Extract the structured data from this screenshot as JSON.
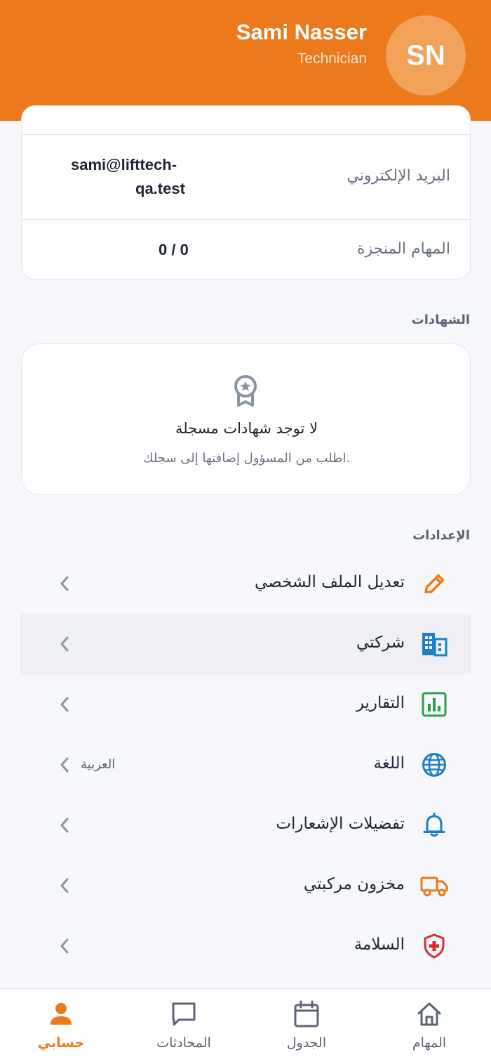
{
  "header": {
    "initials": "SN",
    "name": "Sami Nasser",
    "role": "Technician"
  },
  "info": {
    "email_label": "البريد الإلكتروني",
    "email_value_line1": "sami@lifttech-",
    "email_value_line2": "qa.test",
    "tasks_label": "المهام المنجزة",
    "tasks_value": "0 / 0"
  },
  "certificates": {
    "section_title": "الشهادات",
    "empty_title": "لا توجد شهادات مسجلة",
    "empty_hint": "اطلب من المسؤول إضافتها إلى سجلك."
  },
  "settings": {
    "section_title": "الإعدادات",
    "items": [
      {
        "label": "تعديل الملف الشخصي",
        "icon": "pencil-icon",
        "color": "#ec7a1c"
      },
      {
        "label": "شركتي",
        "icon": "building-icon",
        "color": "#1d7fc4"
      },
      {
        "label": "التقارير",
        "icon": "bar-chart-icon",
        "color": "#2e9e4a"
      },
      {
        "label": "اللغة",
        "icon": "globe-icon",
        "color": "#1d7fc4",
        "value": "العربية"
      },
      {
        "label": "تفضيلات الإشعارات",
        "icon": "bell-icon",
        "color": "#1d7fc4"
      },
      {
        "label": "مخزون مركبتي",
        "icon": "truck-icon",
        "color": "#ec7a1c"
      },
      {
        "label": "السلامة",
        "icon": "shield-medical-icon",
        "color": "#d63031"
      }
    ]
  },
  "nav": {
    "tasks": "المهام",
    "schedule": "الجدول",
    "chats": "المحادثات",
    "account": "حسابي",
    "active_color": "#ec7a1c"
  }
}
